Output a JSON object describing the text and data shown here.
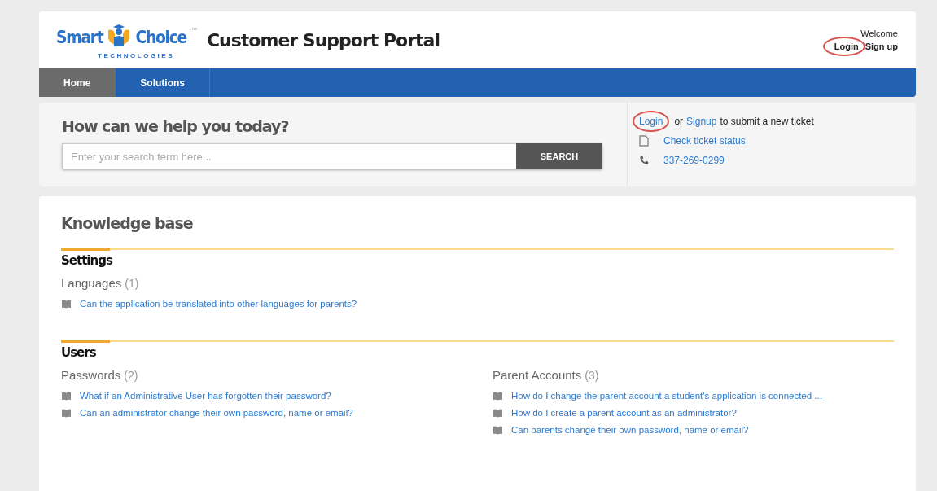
{
  "logo": {
    "word_1": "Smart",
    "word_2": "Choice",
    "tagline": "TECHNOLOGIES",
    "trademark": "™"
  },
  "header": {
    "title": "Customer Support Portal",
    "welcome": "Welcome",
    "login": {
      "label": "Login",
      "circled": true
    },
    "signup": "Sign up"
  },
  "nav": [
    {
      "label": "Home",
      "selected": true
    },
    {
      "label": "Solutions",
      "selected": false
    }
  ],
  "search": {
    "heading": "How can we help you today?",
    "placeholder": "Enter your search term here...",
    "button": "SEARCH"
  },
  "ticket": {
    "login": {
      "label": "Login",
      "circled": true
    },
    "or": "or",
    "signup": "Signup",
    "suffix": "to submit a new ticket",
    "status_link": "Check ticket status",
    "phone": "337-269-0299"
  },
  "knowledge_base": {
    "title": "Knowledge base",
    "sections": [
      {
        "title": "Settings",
        "groups": [
          {
            "name": "Languages",
            "count": "(1)",
            "articles": [
              "Can the application be translated into other languages for parents?"
            ]
          }
        ]
      },
      {
        "title": "Users",
        "groups": [
          {
            "name": "Passwords",
            "count": "(2)",
            "articles": [
              "What if an Administrative User has forgotten their password?",
              "Can an administrator change their own password, name or email?"
            ]
          },
          {
            "name": "Parent Accounts",
            "count": "(3)",
            "articles": [
              "How do I change the parent account a student's application is connected ...",
              "How do I create a parent account as an administrator?",
              "Can parents change their own password, name or email?"
            ]
          }
        ]
      }
    ]
  }
}
